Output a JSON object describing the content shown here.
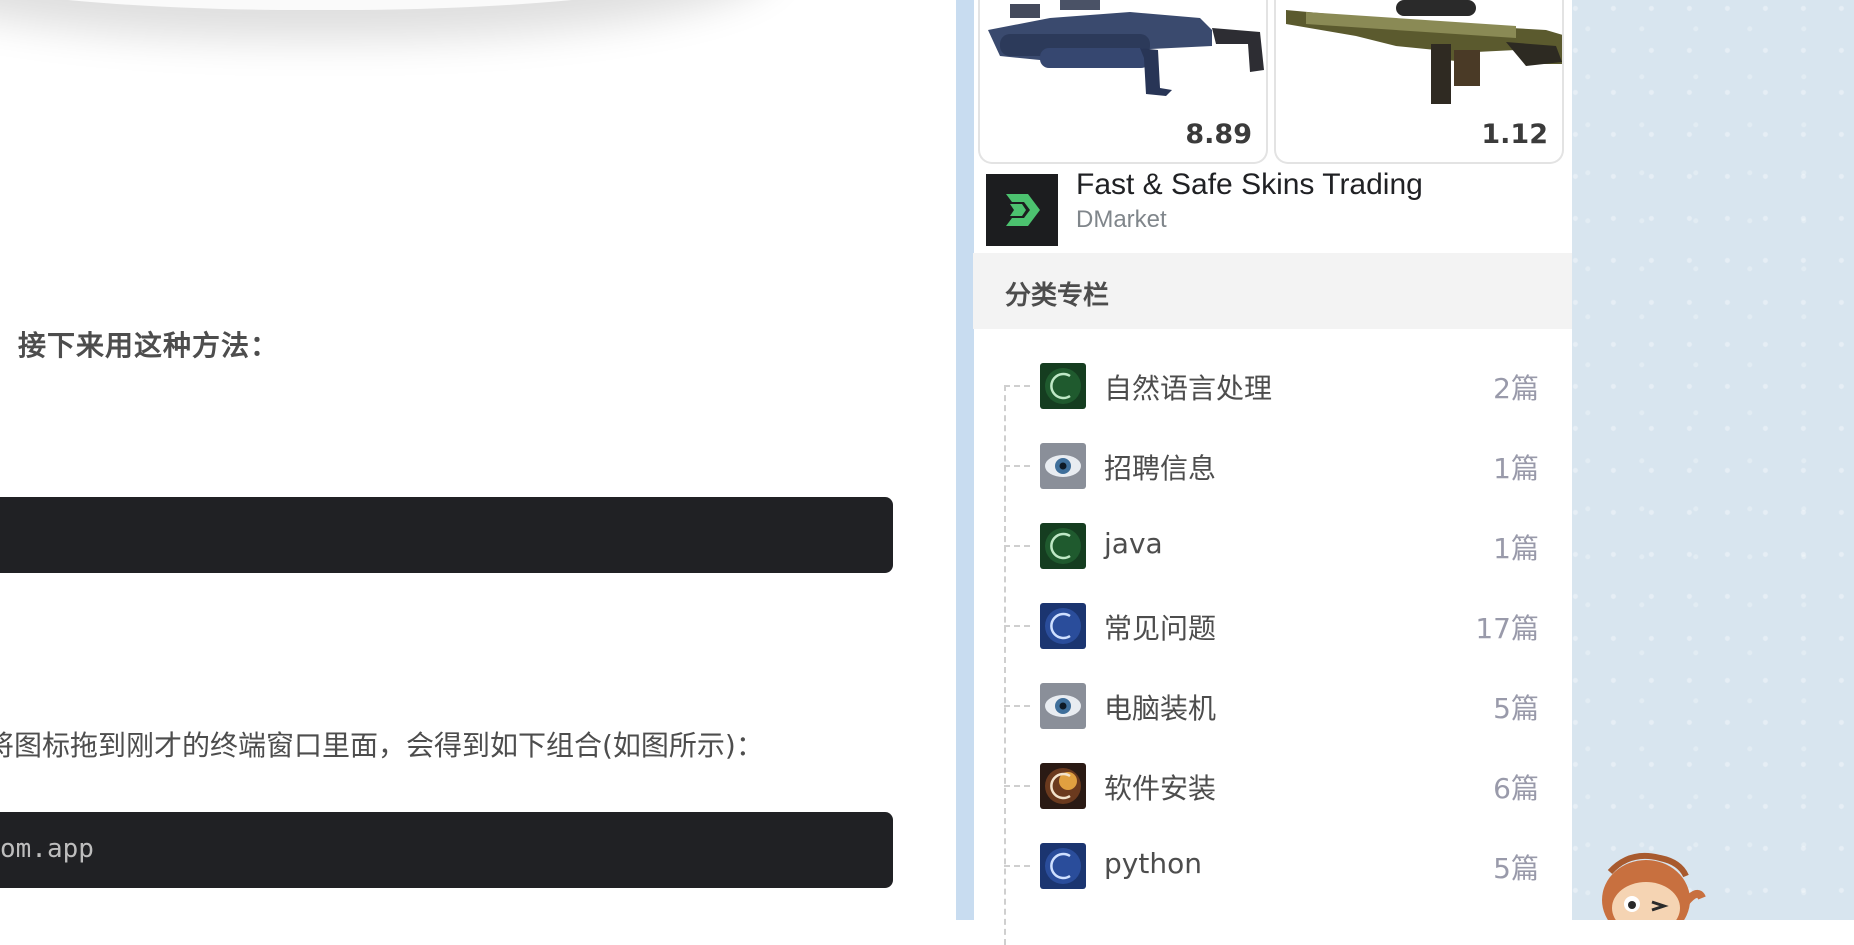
{
  "article": {
    "heading": "接下来用这种方法：",
    "code_line_2": "om.app",
    "paragraph": "将图标拖到刚才的终端窗口里面，会得到如下组合(如图所示)："
  },
  "ad": {
    "items": [
      {
        "price": "8.89",
        "icon": "grenade-launcher-skin-image"
      },
      {
        "price": "1.12",
        "icon": "sniper-rifle-skin-image"
      }
    ],
    "title": "Fast & Safe Skins Trading",
    "brand": "DMarket",
    "logo_color": "#4cc26f"
  },
  "categories": {
    "title": "分类专栏",
    "items": [
      {
        "label": "自然语言处理",
        "count": "2篇",
        "thumb": "green"
      },
      {
        "label": "招聘信息",
        "count": "1篇",
        "thumb": "eye"
      },
      {
        "label": "java",
        "count": "1篇",
        "thumb": "green"
      },
      {
        "label": "常见问题",
        "count": "17篇",
        "thumb": "blue"
      },
      {
        "label": "电脑装机",
        "count": "5篇",
        "thumb": "eye"
      },
      {
        "label": "软件安装",
        "count": "6篇",
        "thumb": "fire"
      },
      {
        "label": "python",
        "count": "5篇",
        "thumb": "blue"
      }
    ]
  },
  "colors": {
    "code_bg": "#202124",
    "sidebar_bg": "#ffffff",
    "page_bg": "#d8e5ef"
  }
}
